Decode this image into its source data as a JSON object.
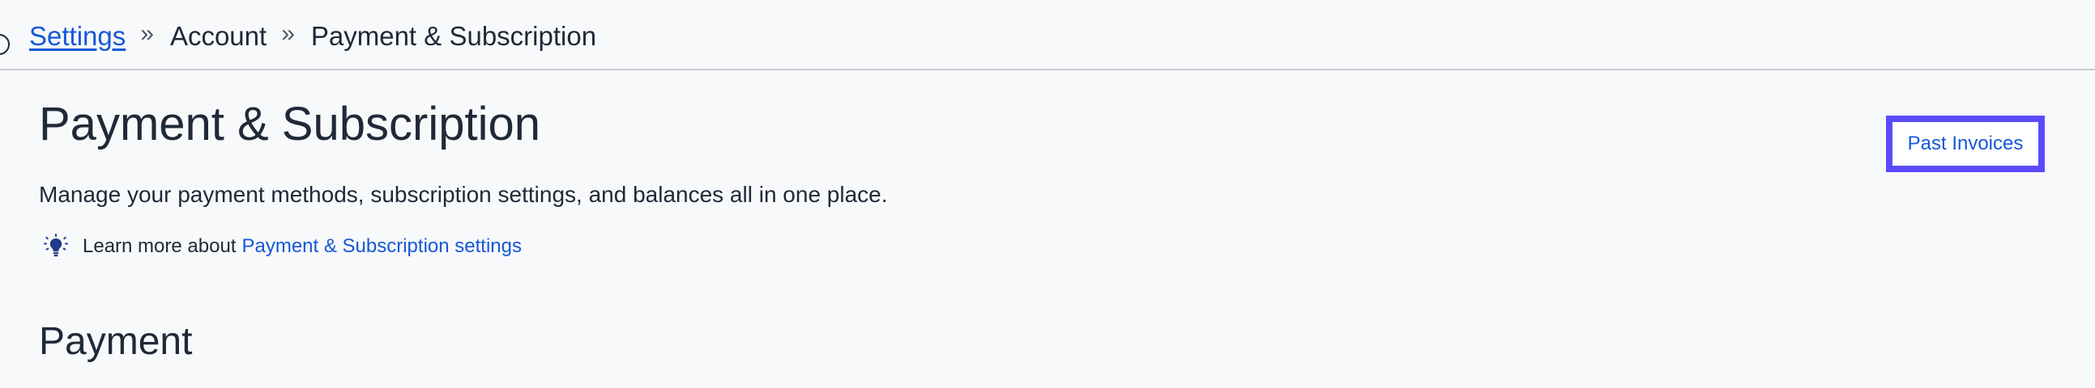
{
  "breadcrumb": {
    "items": [
      {
        "label": "Settings"
      },
      {
        "label": "Account"
      },
      {
        "label": "Payment & Subscription"
      }
    ],
    "separator": "»"
  },
  "header": {
    "title": "Payment & Subscription",
    "description": "Manage your payment methods, subscription settings, and balances all in one place.",
    "learn_more_prefix": "Learn more about",
    "learn_more_link": "Payment & Subscription settings",
    "past_invoices_label": "Past Invoices"
  },
  "sections": {
    "payment_title": "Payment"
  },
  "colors": {
    "link": "#1558d6",
    "focus_ring": "#5b4bff",
    "icon": "#1e3a8a"
  },
  "icons": {
    "learn_more": "lightbulb-icon"
  }
}
